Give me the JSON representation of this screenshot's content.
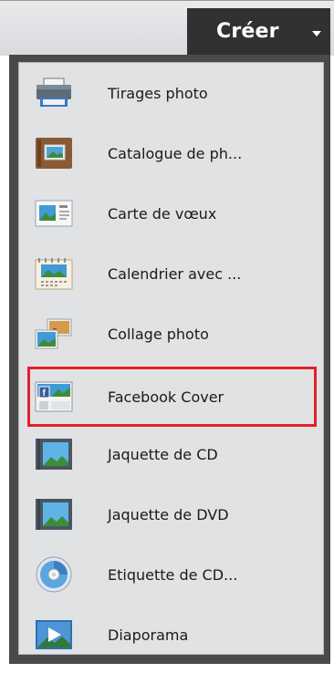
{
  "header": {
    "create_button": "Créer"
  },
  "menu": {
    "items": [
      {
        "label": "Tirages photo",
        "icon": "printer-icon"
      },
      {
        "label": "Catalogue de ph...",
        "icon": "photo-book-icon"
      },
      {
        "label": "Carte de vœux",
        "icon": "greeting-card-icon"
      },
      {
        "label": "Calendrier avec ...",
        "icon": "calendar-icon"
      },
      {
        "label": "Collage photo",
        "icon": "photo-collage-icon"
      },
      {
        "label": "Facebook Cover",
        "icon": "facebook-cover-icon"
      },
      {
        "label": "Jaquette de CD",
        "icon": "cd-jacket-icon"
      },
      {
        "label": "Jaquette de DVD",
        "icon": "dvd-jacket-icon"
      },
      {
        "label": "Etiquette de CD...",
        "icon": "cd-label-icon"
      },
      {
        "label": "Diaporama",
        "icon": "slideshow-icon"
      }
    ]
  },
  "colors": {
    "highlight_border": "#e2202a",
    "button_bg": "#2f3133"
  }
}
